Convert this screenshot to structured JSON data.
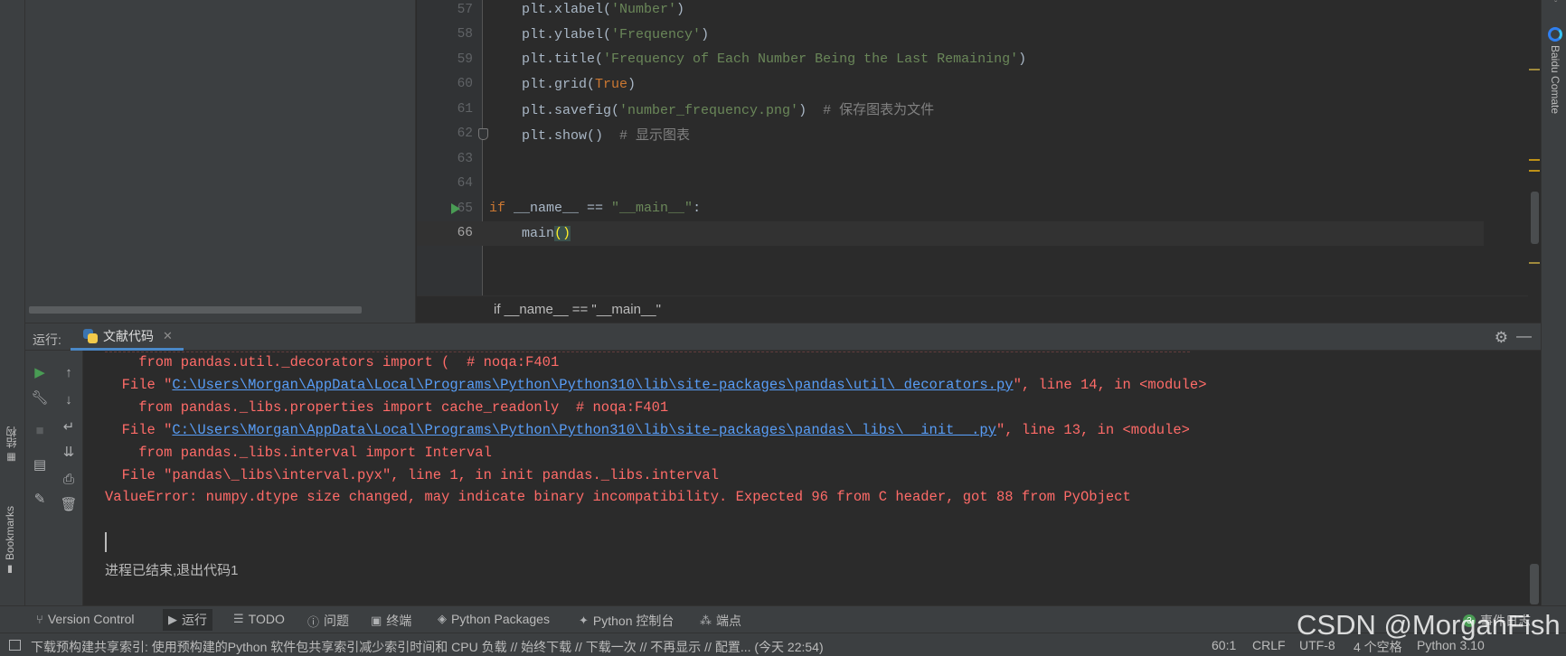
{
  "left_strip": {
    "structure_label": "结构",
    "bookmarks_label": "Bookmarks"
  },
  "editor": {
    "lines": [
      {
        "no": "57",
        "segments": [
          {
            "t": "    plt.xlabel(",
            "c": ""
          },
          {
            "t": "'Number'",
            "c": "t-str"
          },
          {
            "t": ")",
            "c": ""
          }
        ]
      },
      {
        "no": "58",
        "segments": [
          {
            "t": "    plt.ylabel(",
            "c": ""
          },
          {
            "t": "'Frequency'",
            "c": "t-str"
          },
          {
            "t": ")",
            "c": ""
          }
        ]
      },
      {
        "no": "59",
        "segments": [
          {
            "t": "    plt.title(",
            "c": ""
          },
          {
            "t": "'Frequency of Each Number Being the Last Remaining'",
            "c": "t-str"
          },
          {
            "t": ")",
            "c": ""
          }
        ]
      },
      {
        "no": "60",
        "segments": [
          {
            "t": "    plt.grid(",
            "c": ""
          },
          {
            "t": "True",
            "c": "t-kw"
          },
          {
            "t": ")",
            "c": ""
          }
        ]
      },
      {
        "no": "61",
        "segments": [
          {
            "t": "    plt.savefig(",
            "c": ""
          },
          {
            "t": "'number_frequency.png'",
            "c": "t-str"
          },
          {
            "t": ")  ",
            "c": ""
          },
          {
            "t": "# 保存图表为文件",
            "c": "t-cm"
          }
        ]
      },
      {
        "no": "62",
        "segments": [
          {
            "t": "    plt.show()  ",
            "c": ""
          },
          {
            "t": "# 显示图表",
            "c": "t-cm"
          }
        ]
      },
      {
        "no": "63",
        "segments": []
      },
      {
        "no": "64",
        "segments": []
      },
      {
        "no": "65",
        "segments": [
          {
            "t": "if ",
            "c": "t-kw"
          },
          {
            "t": "__name__ == ",
            "c": ""
          },
          {
            "t": "\"__main__\"",
            "c": "t-str"
          },
          {
            "t": ":",
            "c": ""
          }
        ]
      },
      {
        "no": "66",
        "segments": [
          {
            "t": "    main",
            "c": ""
          },
          {
            "t": "()",
            "c": "t-paren"
          }
        ]
      }
    ],
    "breadcrumb": "if __name__ == \"__main__\""
  },
  "right_strip": {
    "comate_label": "Baidu Comate"
  },
  "run_panel": {
    "label": "运行:",
    "tab_name": "文献代码",
    "console_lines": [
      {
        "text": "    from pandas.util._decorators import (  # noqa:F401"
      },
      {
        "pre": "  File \"",
        "link": "C:\\Users\\Morgan\\AppData\\Local\\Programs\\Python\\Python310\\lib\\site-packages\\pandas\\util\\_decorators.py",
        "post": "\", line 14, in <module>"
      },
      {
        "text": "    from pandas._libs.properties import cache_readonly  # noqa:F401"
      },
      {
        "pre": "  File \"",
        "link": "C:\\Users\\Morgan\\AppData\\Local\\Programs\\Python\\Python310\\lib\\site-packages\\pandas\\_libs\\__init__.py",
        "post": "\", line 13, in <module>"
      },
      {
        "text": "    from pandas._libs.interval import Interval"
      },
      {
        "text": "  File \"pandas\\_libs\\interval.pyx\", line 1, in init pandas._libs.interval"
      },
      {
        "text": "ValueError: numpy.dtype size changed, may indicate binary incompatibility. Expected 96 from C header, got 88 from PyObject"
      }
    ],
    "exit_message": "进程已结束,退出代码1"
  },
  "tool_windows": {
    "version_control": "Version Control",
    "run": "运行",
    "todo": "TODO",
    "problems": "问题",
    "terminal": "终端",
    "python_packages": "Python Packages",
    "python_console": "Python 控制台",
    "endpoints": "端点",
    "event_log": "事件日志",
    "event_count": "3"
  },
  "status_bar": {
    "message": "下载预构建共享索引: 使用预构建的Python 软件包共享索引减少索引时间和 CPU 负载 // 始终下载 // 下载一次 // 不再显示 // 配置... (今天 22:54)",
    "position": "60:1",
    "line_sep": "CRLF",
    "encoding": "UTF-8",
    "indent": "4 个空格",
    "interpreter": "Python 3.10"
  },
  "watermark": "CSDN @MorganFish"
}
